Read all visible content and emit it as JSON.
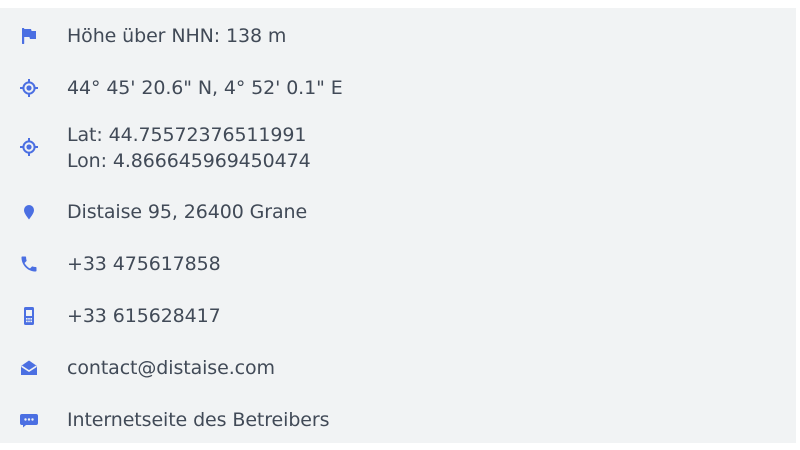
{
  "accent_color": "#4b6fe2",
  "rows": [
    {
      "icon": "flag-icon",
      "text": "Höhe über NHN: 138 m"
    },
    {
      "icon": "gps-target-icon",
      "text": "44° 45' 20.6\" N, 4° 52' 0.1\" E"
    },
    {
      "icon": "gps-target-icon",
      "lat": "Lat: 44.75572376511991",
      "lon": "Lon: 4.866645969450474"
    },
    {
      "icon": "map-pin-icon",
      "text": "Distaise 95, 26400 Grane"
    },
    {
      "icon": "phone-icon",
      "text": "+33 475617858"
    },
    {
      "icon": "mobile-phone-icon",
      "text": "+33 615628417"
    },
    {
      "icon": "email-icon",
      "text": "contact@distaise.com"
    },
    {
      "icon": "website-icon",
      "text": "Internetseite des Betreibers"
    }
  ]
}
